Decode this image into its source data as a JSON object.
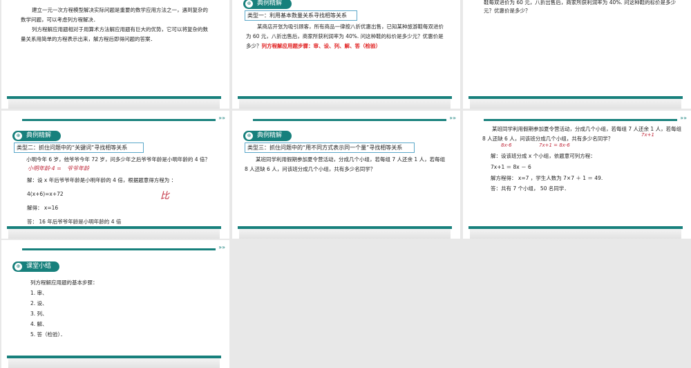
{
  "slides": [
    {
      "paragraphs": [
        "建立一元一次方程模型解决实际问题是重要的数学应用方法之一，遇到复杂的数学问题，可以考虑列方程解决．",
        "列方程解应用题相对于用算术方法解应用题有巨大的优势，它可以将复杂的数量关系用简单的方程表示出来，解方程后即得问题的答案．"
      ]
    },
    {
      "badge": "典例精解",
      "type": "类型一：利用基本数量关系寻找相等关系",
      "problem": "某商店开张为吸引顾客，所有商品一律按八折优惠出售，已知某种旅游鞋每双进价为 60 元，八折出售后，商家所获利润率为 40%. 问这种鞋的标价是多少元？优惠价是多少？",
      "steps": "列方程解应用题步骤：审、设、列、解、答（检验）"
    },
    {
      "problem": "鞋每双进价为 60 元，八折出售后，商家所获利润率为 40%. 问这种鞋的标价是多少元？优惠价是多少？"
    },
    {
      "badge": "典例精解",
      "type": "类型二：抓住问题中的“关键词”寻找相等关系",
      "problem": "小明今年 6 岁，他爷爷今年 72 岁，问多少年之后爷爷年龄是小明年龄的 4 倍？",
      "solve": "解：设 x 年后爷爷年龄是小明年龄的 4 倍，根据题意得方程为 ：",
      "equation": "4(x+6)=x+72",
      "result": "解得： x=16",
      "answer": "答： 16 年后爷爷年龄是小明年龄的 4 倍",
      "handwriting": [
        "小明年龄·4 =",
        "爷爷年龄",
        "比"
      ]
    },
    {
      "badge": "典例精解",
      "type": "类型三：抓住问题中的“用不同方式表示同一个量”寻找相等关系",
      "problem": "某班同学利用假期参加夏令营活动，分成几个小组，若每组 7 人还余 1 人，若每组 8 人还缺 6 人，问该班分成几个小组，共有多少名同学？"
    },
    {
      "problem": "某班同学利用假期参加夏令营活动，分成几个小组，若每组 7 人还余 1 人，若每组 8 人还缺 6 人，问该班分成几个小组，共有多少名同学？",
      "solve": "解：设该班分成 x 个小组，依题意可列方程：",
      "equation": "7x+1 ＝ 8x － 6",
      "result": "解方程得： x=7 ，学生人数为 7×7 ＋ 1 ＝ 49.",
      "answer": "答：共有 7 个小组， 50 名同学．",
      "handwriting": [
        "7x+1",
        "8x-6",
        "7x+1 = 8x-6"
      ]
    },
    {
      "badge": "课堂小结",
      "heading": "列方程解应用题的基本步骤：",
      "items": [
        "1. 审、",
        "2. 设、",
        "3. 列、",
        "4. 解、",
        "5. 答（检验）．"
      ]
    }
  ],
  "colors": {
    "accent": "#17807c",
    "highlight": "#e02020",
    "background": "#e8e8e8"
  }
}
